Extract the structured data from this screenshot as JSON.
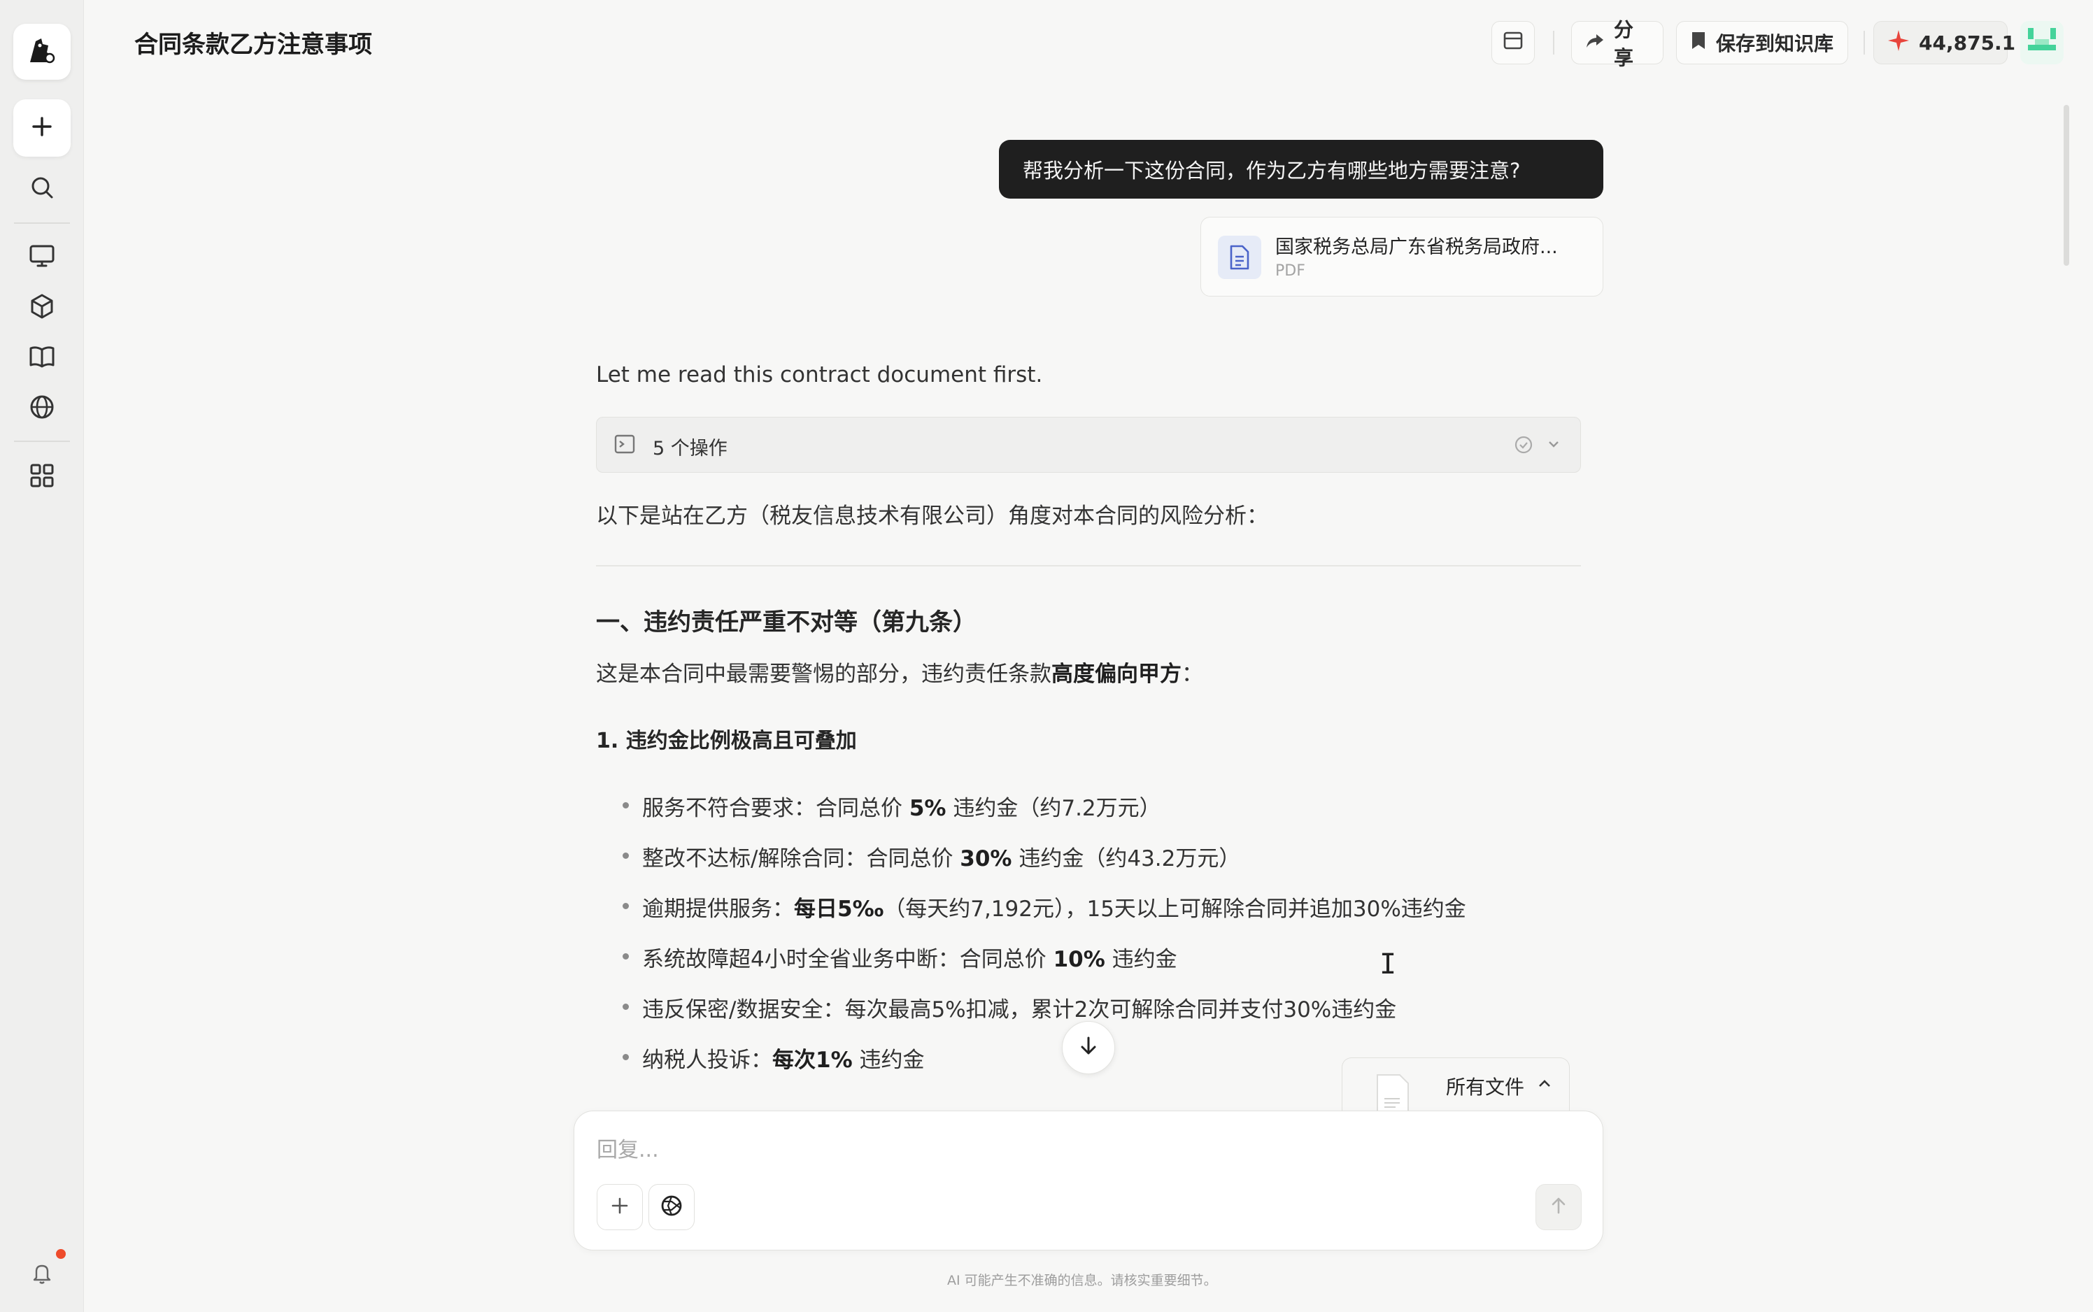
{
  "app": {
    "title": "合同条款乙方注意事项"
  },
  "sidebar": {
    "items": [
      {
        "icon": "logo-icon"
      },
      {
        "icon": "plus-icon",
        "label": "new-chat"
      },
      {
        "icon": "search-icon"
      },
      {
        "icon": "monitor-icon"
      },
      {
        "icon": "cube-icon"
      },
      {
        "icon": "book-icon"
      },
      {
        "icon": "globe-icon"
      },
      {
        "icon": "grid-icon"
      },
      {
        "icon": "bell-icon"
      }
    ],
    "notification_color": "#ee4b2b"
  },
  "toolbar": {
    "share_label": "分享",
    "save_label": "保存到知识库",
    "points": "44,875.1",
    "points_icon_color": "#e8453c",
    "avatar_color": "#44d39a"
  },
  "conversation": {
    "user_message": "帮我分析一下这份合同，作为乙方有哪些地方需要注意?",
    "attachment": {
      "name": "国家税务总局广东省税务局政府...",
      "type": "PDF"
    },
    "assistant": {
      "intro": "Let me read this contract document first.",
      "operations_label": "5 个操作",
      "summary": "以下是站在乙方（税友信息技术有限公司）角度对本合同的风险分析：",
      "section_title": "一、违约责任严重不对等（第九条）",
      "section_lead": "这是本合同中最需要警惕的部分，违约责任条款",
      "section_lead_bold": "高度偏向甲方",
      "section_lead_end": "：",
      "subsection_title": "1. 违约金比例极高且可叠加",
      "bullets": [
        {
          "pre": "服务不符合要求：合同总价 ",
          "bold": "5%",
          "post": " 违约金（约7.2万元）"
        },
        {
          "pre": "整改不达标/解除合同：合同总价 ",
          "bold": "30%",
          "post": " 违约金（约43.2万元）"
        },
        {
          "pre": "逾期提供服务：",
          "bold": "每日5‰",
          "post": "（每天约7,192元），15天以上可解除合同并追加30%违约金"
        },
        {
          "pre": "系统故障超4小时全省业务中断：合同总价 ",
          "bold": "10%",
          "post": " 违约金"
        },
        {
          "pre": "违反保密/数据安全：每次最高5%扣减，累计2次可解除合同并支付30%违约金",
          "bold": "",
          "post": ""
        },
        {
          "pre": "纳税人投诉：",
          "bold": "每次1%",
          "post": " 违约金"
        }
      ]
    }
  },
  "files_panel": {
    "label": "所有文件"
  },
  "composer": {
    "placeholder": "回复..."
  },
  "footer": {
    "disclaimer": "AI 可能产生不准确的信息。请核实重要细节。"
  }
}
